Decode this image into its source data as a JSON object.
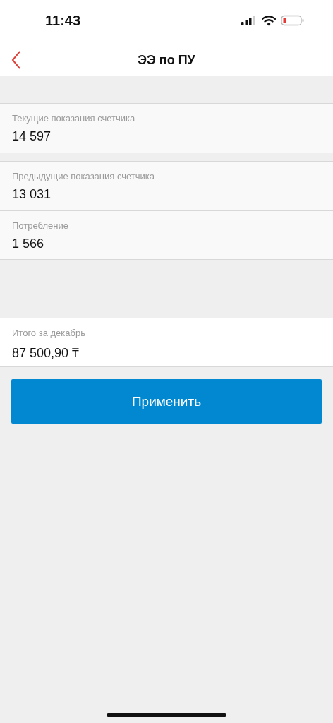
{
  "status_bar": {
    "time": "11:43"
  },
  "nav_bar": {
    "title": "ЭЭ по ПУ"
  },
  "groups": [
    {
      "fields": [
        {
          "label": "Текущие показания счетчика",
          "value": "14 597"
        }
      ]
    },
    {
      "fields": [
        {
          "label": "Предыдущие показания счетчика",
          "value": "13 031"
        },
        {
          "label": "Потребление",
          "value": "1 566"
        }
      ]
    }
  ],
  "total": {
    "label": "Итого за декабрь",
    "value": "87 500,90 ₸"
  },
  "apply_button": {
    "label": "Применить"
  }
}
